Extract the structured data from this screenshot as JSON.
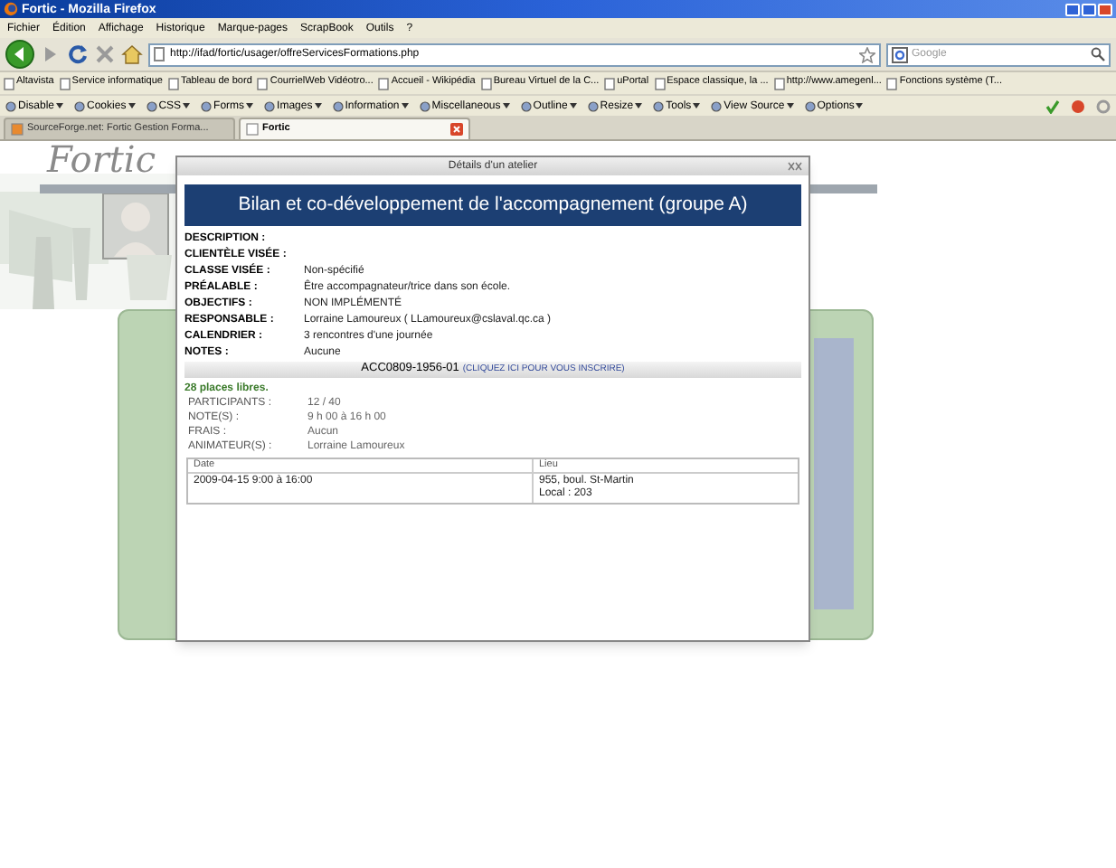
{
  "browser": {
    "title": "Fortic - Mozilla Firefox",
    "menu": [
      "Fichier",
      "Édition",
      "Affichage",
      "Historique",
      "Marque-pages",
      "ScrapBook",
      "Outils",
      "?"
    ],
    "url": "http://ifad/fortic/usager/offreServicesFormations.php",
    "search": {
      "placeholder": "Google"
    },
    "bookmarks": [
      "Altavista",
      "Service informatique",
      "Tableau de bord",
      "CourrielWeb Vidéotro...",
      "Accueil - Wikipédia",
      "Bureau Virtuel de la C...",
      "uPortal",
      "Espace classique, la ...",
      "http://www.amegenl...",
      "Fonctions système (T..."
    ],
    "dev_toolbar": [
      "Disable",
      "Cookies",
      "CSS",
      "Forms",
      "Images",
      "Information",
      "Miscellaneous",
      "Outline",
      "Resize",
      "Tools",
      "View Source",
      "Options"
    ],
    "tabs": [
      {
        "label": "SourceForge.net: Fortic Gestion Forma...",
        "selected": false
      },
      {
        "label": "Fortic",
        "selected": true
      }
    ]
  },
  "page": {
    "logo": "Fortic"
  },
  "modal": {
    "title": "Détails d'un atelier",
    "heading": "Bilan et co-développement de l'accompagnement (groupe A)",
    "fields": [
      {
        "label": "DESCRIPTION :"
      },
      {
        "label": "CLIENTÈLE VISÉE :"
      },
      {
        "label": "CLASSE VISÉE :",
        "value": "Non-spécifié"
      },
      {
        "label": "PRÉALABLE :",
        "value": "Être accompagnateur/trice dans son école."
      },
      {
        "label": "OBJECTIFS :",
        "value": "NON IMPLÉMENTÉ"
      },
      {
        "label": "RESPONSABLE :",
        "value": "Lorraine Lamoureux ( LLamoureux@cslaval.qc.ca )"
      },
      {
        "label": "CALENDRIER :",
        "value": "3 rencontres d'une journée"
      },
      {
        "label": "NOTES :",
        "value": "Aucune"
      }
    ],
    "code": "ACC0809-1956-01",
    "register_link": "(CLIQUEZ ICI POUR VOUS INSCRIRE)",
    "places": "28 places libres.",
    "details": [
      {
        "label": "PARTICIPANTS :",
        "value": "12 / 40"
      },
      {
        "label": "NOTE(S) :",
        "value": "9 h 00 à 16 h 00"
      },
      {
        "label": "FRAIS :",
        "value": "Aucun"
      },
      {
        "label": "ANIMATEUR(S) :",
        "value": "Lorraine Lamoureux"
      }
    ],
    "table": {
      "columns": [
        "Date",
        "Lieu"
      ],
      "rows": [
        [
          [
            "2009-04-15 9:00 à 16:00"
          ],
          [
            "955, boul. St-Martin",
            "Local : 203"
          ]
        ]
      ]
    }
  }
}
